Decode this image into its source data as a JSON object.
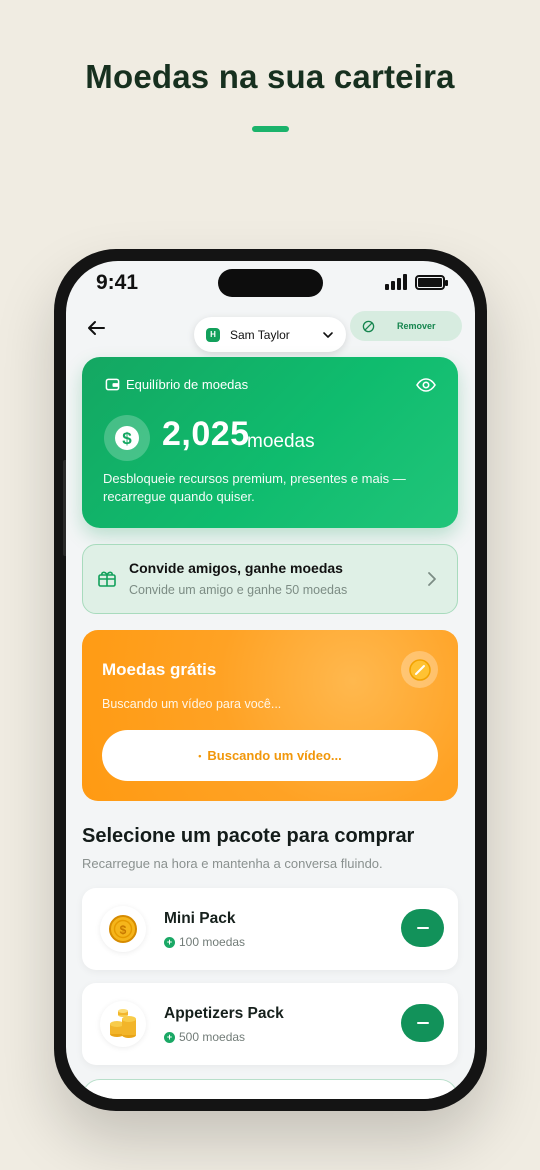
{
  "headline": "Moedas na sua carteira",
  "status_bar": {
    "time": "9:41"
  },
  "header": {
    "user": {
      "initial": "H",
      "name": "Sam Taylor"
    },
    "remove_label": "Remover"
  },
  "balance": {
    "title": "Equilíbrio de moedas",
    "amount": "2,025",
    "unit": "moedas",
    "description": "Desbloqueie recursos premium, presentes e mais — recarregue quando quiser."
  },
  "invite": {
    "title": "Convide amigos, ganhe moedas",
    "subtitle": "Convide um amigo e ganhe 50 moedas"
  },
  "free_coins": {
    "title": "Moedas grátis",
    "subtitle": "Buscando um vídeo para você...",
    "button_label": "Buscando um vídeo..."
  },
  "packs_section": {
    "title": "Selecione um pacote para comprar",
    "subtitle": "Recarregue na hora e mantenha a conversa fluindo.",
    "packs": [
      {
        "name": "Mini Pack",
        "coins": "100 moedas"
      },
      {
        "name": "Appetizers Pack",
        "coins": "500 moedas"
      }
    ]
  },
  "colors": {
    "accent": "#12a05b",
    "orange": "#ffa224",
    "background": "#f0ece2"
  }
}
